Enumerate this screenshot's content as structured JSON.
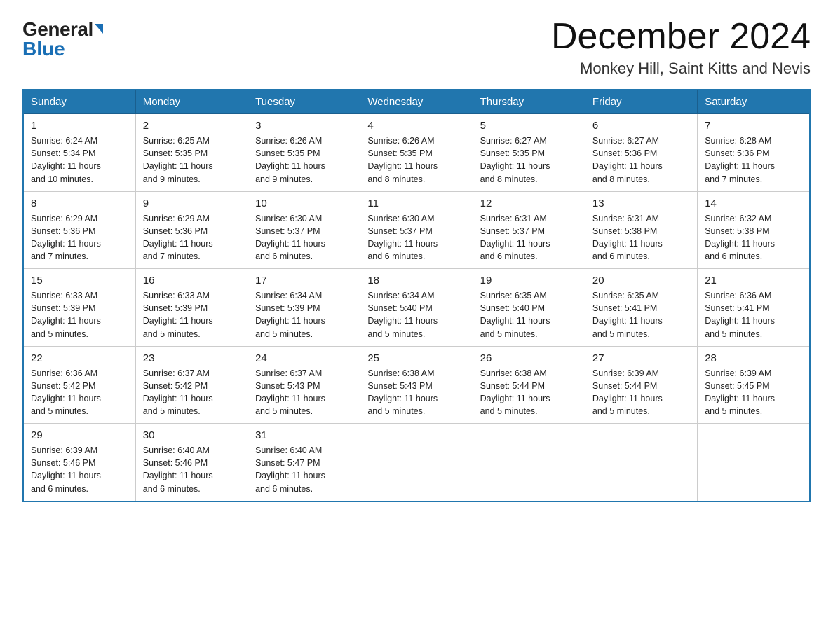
{
  "logo": {
    "general": "General",
    "blue": "Blue"
  },
  "title": "December 2024",
  "location": "Monkey Hill, Saint Kitts and Nevis",
  "weekdays": [
    "Sunday",
    "Monday",
    "Tuesday",
    "Wednesday",
    "Thursday",
    "Friday",
    "Saturday"
  ],
  "weeks": [
    [
      {
        "day": "1",
        "sunrise": "6:24 AM",
        "sunset": "5:34 PM",
        "daylight": "11 hours and 10 minutes."
      },
      {
        "day": "2",
        "sunrise": "6:25 AM",
        "sunset": "5:35 PM",
        "daylight": "11 hours and 9 minutes."
      },
      {
        "day": "3",
        "sunrise": "6:26 AM",
        "sunset": "5:35 PM",
        "daylight": "11 hours and 9 minutes."
      },
      {
        "day": "4",
        "sunrise": "6:26 AM",
        "sunset": "5:35 PM",
        "daylight": "11 hours and 8 minutes."
      },
      {
        "day": "5",
        "sunrise": "6:27 AM",
        "sunset": "5:35 PM",
        "daylight": "11 hours and 8 minutes."
      },
      {
        "day": "6",
        "sunrise": "6:27 AM",
        "sunset": "5:36 PM",
        "daylight": "11 hours and 8 minutes."
      },
      {
        "day": "7",
        "sunrise": "6:28 AM",
        "sunset": "5:36 PM",
        "daylight": "11 hours and 7 minutes."
      }
    ],
    [
      {
        "day": "8",
        "sunrise": "6:29 AM",
        "sunset": "5:36 PM",
        "daylight": "11 hours and 7 minutes."
      },
      {
        "day": "9",
        "sunrise": "6:29 AM",
        "sunset": "5:36 PM",
        "daylight": "11 hours and 7 minutes."
      },
      {
        "day": "10",
        "sunrise": "6:30 AM",
        "sunset": "5:37 PM",
        "daylight": "11 hours and 6 minutes."
      },
      {
        "day": "11",
        "sunrise": "6:30 AM",
        "sunset": "5:37 PM",
        "daylight": "11 hours and 6 minutes."
      },
      {
        "day": "12",
        "sunrise": "6:31 AM",
        "sunset": "5:37 PM",
        "daylight": "11 hours and 6 minutes."
      },
      {
        "day": "13",
        "sunrise": "6:31 AM",
        "sunset": "5:38 PM",
        "daylight": "11 hours and 6 minutes."
      },
      {
        "day": "14",
        "sunrise": "6:32 AM",
        "sunset": "5:38 PM",
        "daylight": "11 hours and 6 minutes."
      }
    ],
    [
      {
        "day": "15",
        "sunrise": "6:33 AM",
        "sunset": "5:39 PM",
        "daylight": "11 hours and 5 minutes."
      },
      {
        "day": "16",
        "sunrise": "6:33 AM",
        "sunset": "5:39 PM",
        "daylight": "11 hours and 5 minutes."
      },
      {
        "day": "17",
        "sunrise": "6:34 AM",
        "sunset": "5:39 PM",
        "daylight": "11 hours and 5 minutes."
      },
      {
        "day": "18",
        "sunrise": "6:34 AM",
        "sunset": "5:40 PM",
        "daylight": "11 hours and 5 minutes."
      },
      {
        "day": "19",
        "sunrise": "6:35 AM",
        "sunset": "5:40 PM",
        "daylight": "11 hours and 5 minutes."
      },
      {
        "day": "20",
        "sunrise": "6:35 AM",
        "sunset": "5:41 PM",
        "daylight": "11 hours and 5 minutes."
      },
      {
        "day": "21",
        "sunrise": "6:36 AM",
        "sunset": "5:41 PM",
        "daylight": "11 hours and 5 minutes."
      }
    ],
    [
      {
        "day": "22",
        "sunrise": "6:36 AM",
        "sunset": "5:42 PM",
        "daylight": "11 hours and 5 minutes."
      },
      {
        "day": "23",
        "sunrise": "6:37 AM",
        "sunset": "5:42 PM",
        "daylight": "11 hours and 5 minutes."
      },
      {
        "day": "24",
        "sunrise": "6:37 AM",
        "sunset": "5:43 PM",
        "daylight": "11 hours and 5 minutes."
      },
      {
        "day": "25",
        "sunrise": "6:38 AM",
        "sunset": "5:43 PM",
        "daylight": "11 hours and 5 minutes."
      },
      {
        "day": "26",
        "sunrise": "6:38 AM",
        "sunset": "5:44 PM",
        "daylight": "11 hours and 5 minutes."
      },
      {
        "day": "27",
        "sunrise": "6:39 AM",
        "sunset": "5:44 PM",
        "daylight": "11 hours and 5 minutes."
      },
      {
        "day": "28",
        "sunrise": "6:39 AM",
        "sunset": "5:45 PM",
        "daylight": "11 hours and 5 minutes."
      }
    ],
    [
      {
        "day": "29",
        "sunrise": "6:39 AM",
        "sunset": "5:46 PM",
        "daylight": "11 hours and 6 minutes."
      },
      {
        "day": "30",
        "sunrise": "6:40 AM",
        "sunset": "5:46 PM",
        "daylight": "11 hours and 6 minutes."
      },
      {
        "day": "31",
        "sunrise": "6:40 AM",
        "sunset": "5:47 PM",
        "daylight": "11 hours and 6 minutes."
      },
      null,
      null,
      null,
      null
    ]
  ],
  "labels": {
    "sunrise": "Sunrise:",
    "sunset": "Sunset:",
    "daylight": "Daylight:"
  }
}
